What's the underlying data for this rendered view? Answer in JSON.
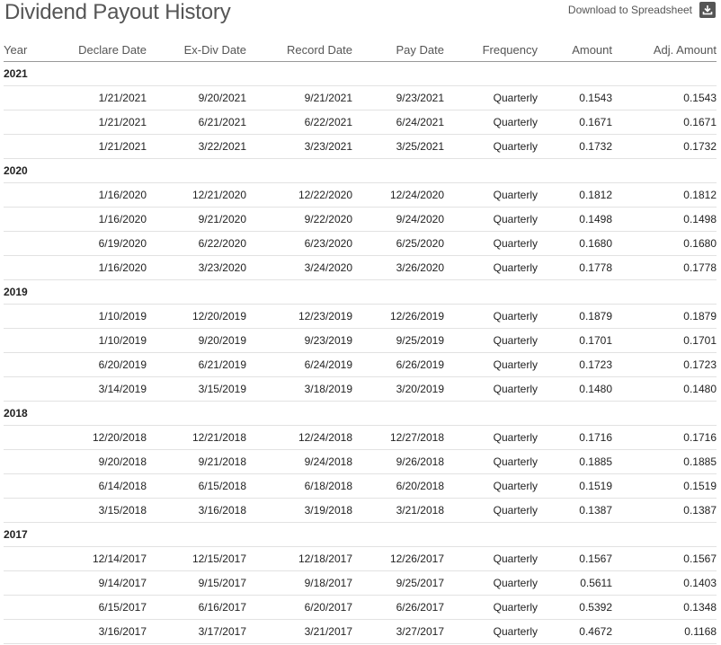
{
  "page": {
    "title": "Dividend Payout History",
    "download_label": "Download to Spreadsheet"
  },
  "table": {
    "columns": [
      "Year",
      "Declare Date",
      "Ex-Div Date",
      "Record Date",
      "Pay Date",
      "Frequency",
      "Amount",
      "Adj. Amount"
    ],
    "groups": [
      {
        "year": "2021",
        "rows": [
          [
            "1/21/2021",
            "9/20/2021",
            "9/21/2021",
            "9/23/2021",
            "Quarterly",
            "0.1543",
            "0.1543"
          ],
          [
            "1/21/2021",
            "6/21/2021",
            "6/22/2021",
            "6/24/2021",
            "Quarterly",
            "0.1671",
            "0.1671"
          ],
          [
            "1/21/2021",
            "3/22/2021",
            "3/23/2021",
            "3/25/2021",
            "Quarterly",
            "0.1732",
            "0.1732"
          ]
        ]
      },
      {
        "year": "2020",
        "rows": [
          [
            "1/16/2020",
            "12/21/2020",
            "12/22/2020",
            "12/24/2020",
            "Quarterly",
            "0.1812",
            "0.1812"
          ],
          [
            "1/16/2020",
            "9/21/2020",
            "9/22/2020",
            "9/24/2020",
            "Quarterly",
            "0.1498",
            "0.1498"
          ],
          [
            "6/19/2020",
            "6/22/2020",
            "6/23/2020",
            "6/25/2020",
            "Quarterly",
            "0.1680",
            "0.1680"
          ],
          [
            "1/16/2020",
            "3/23/2020",
            "3/24/2020",
            "3/26/2020",
            "Quarterly",
            "0.1778",
            "0.1778"
          ]
        ]
      },
      {
        "year": "2019",
        "rows": [
          [
            "1/10/2019",
            "12/20/2019",
            "12/23/2019",
            "12/26/2019",
            "Quarterly",
            "0.1879",
            "0.1879"
          ],
          [
            "1/10/2019",
            "9/20/2019",
            "9/23/2019",
            "9/25/2019",
            "Quarterly",
            "0.1701",
            "0.1701"
          ],
          [
            "6/20/2019",
            "6/21/2019",
            "6/24/2019",
            "6/26/2019",
            "Quarterly",
            "0.1723",
            "0.1723"
          ],
          [
            "3/14/2019",
            "3/15/2019",
            "3/18/2019",
            "3/20/2019",
            "Quarterly",
            "0.1480",
            "0.1480"
          ]
        ]
      },
      {
        "year": "2018",
        "rows": [
          [
            "12/20/2018",
            "12/21/2018",
            "12/24/2018",
            "12/27/2018",
            "Quarterly",
            "0.1716",
            "0.1716"
          ],
          [
            "9/20/2018",
            "9/21/2018",
            "9/24/2018",
            "9/26/2018",
            "Quarterly",
            "0.1885",
            "0.1885"
          ],
          [
            "6/14/2018",
            "6/15/2018",
            "6/18/2018",
            "6/20/2018",
            "Quarterly",
            "0.1519",
            "0.1519"
          ],
          [
            "3/15/2018",
            "3/16/2018",
            "3/19/2018",
            "3/21/2018",
            "Quarterly",
            "0.1387",
            "0.1387"
          ]
        ]
      },
      {
        "year": "2017",
        "rows": [
          [
            "12/14/2017",
            "12/15/2017",
            "12/18/2017",
            "12/26/2017",
            "Quarterly",
            "0.1567",
            "0.1567"
          ],
          [
            "9/14/2017",
            "9/15/2017",
            "9/18/2017",
            "9/25/2017",
            "Quarterly",
            "0.5611",
            "0.1403"
          ],
          [
            "6/15/2017",
            "6/16/2017",
            "6/20/2017",
            "6/26/2017",
            "Quarterly",
            "0.5392",
            "0.1348"
          ],
          [
            "3/16/2017",
            "3/17/2017",
            "3/21/2017",
            "3/27/2017",
            "Quarterly",
            "0.4672",
            "0.1168"
          ]
        ]
      }
    ]
  }
}
